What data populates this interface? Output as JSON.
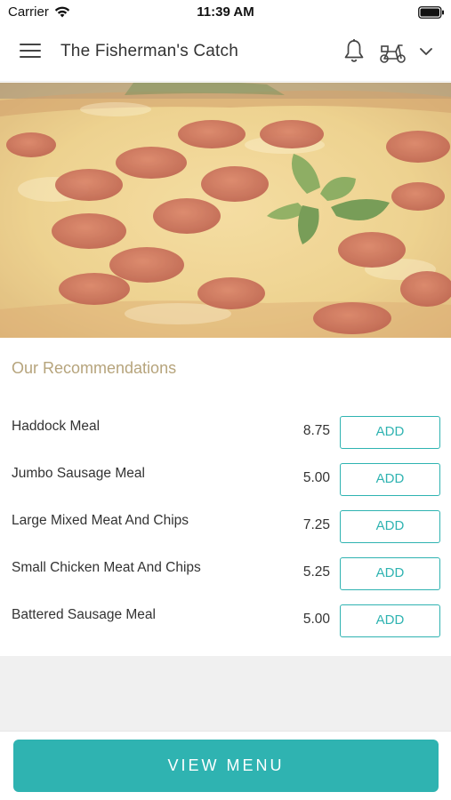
{
  "status_bar": {
    "carrier": "Carrier",
    "time": "11:39 AM",
    "wifi_icon": "wifi-icon",
    "battery_icon": "battery-icon"
  },
  "header": {
    "title": "The Fisherman's Catch",
    "menu_icon": "hamburger-menu-icon",
    "bell_icon": "bell-icon",
    "delivery_icon": "delivery-scooter-icon",
    "dropdown_icon": "chevron-down-icon"
  },
  "hero": {
    "image": "pepperoni-pizza-photo"
  },
  "recommendations": {
    "title": "Our Recommendations",
    "items": [
      {
        "name": "Haddock Meal",
        "price": "8.75",
        "button": "ADD"
      },
      {
        "name": "Jumbo Sausage Meal",
        "price": "5.00",
        "button": "ADD"
      },
      {
        "name": "Large Mixed Meat And Chips",
        "price": "7.25",
        "button": "ADD"
      },
      {
        "name": "Small Chicken Meat And Chips",
        "price": "5.25",
        "button": "ADD"
      },
      {
        "name": "Battered Sausage Meal",
        "price": "5.00",
        "button": "ADD"
      }
    ]
  },
  "footer": {
    "view_menu_label": "VIEW MENU"
  },
  "colors": {
    "accent": "#2fb3b1",
    "section_title": "#b6a47c",
    "grey_area": "#f0f0f0"
  }
}
